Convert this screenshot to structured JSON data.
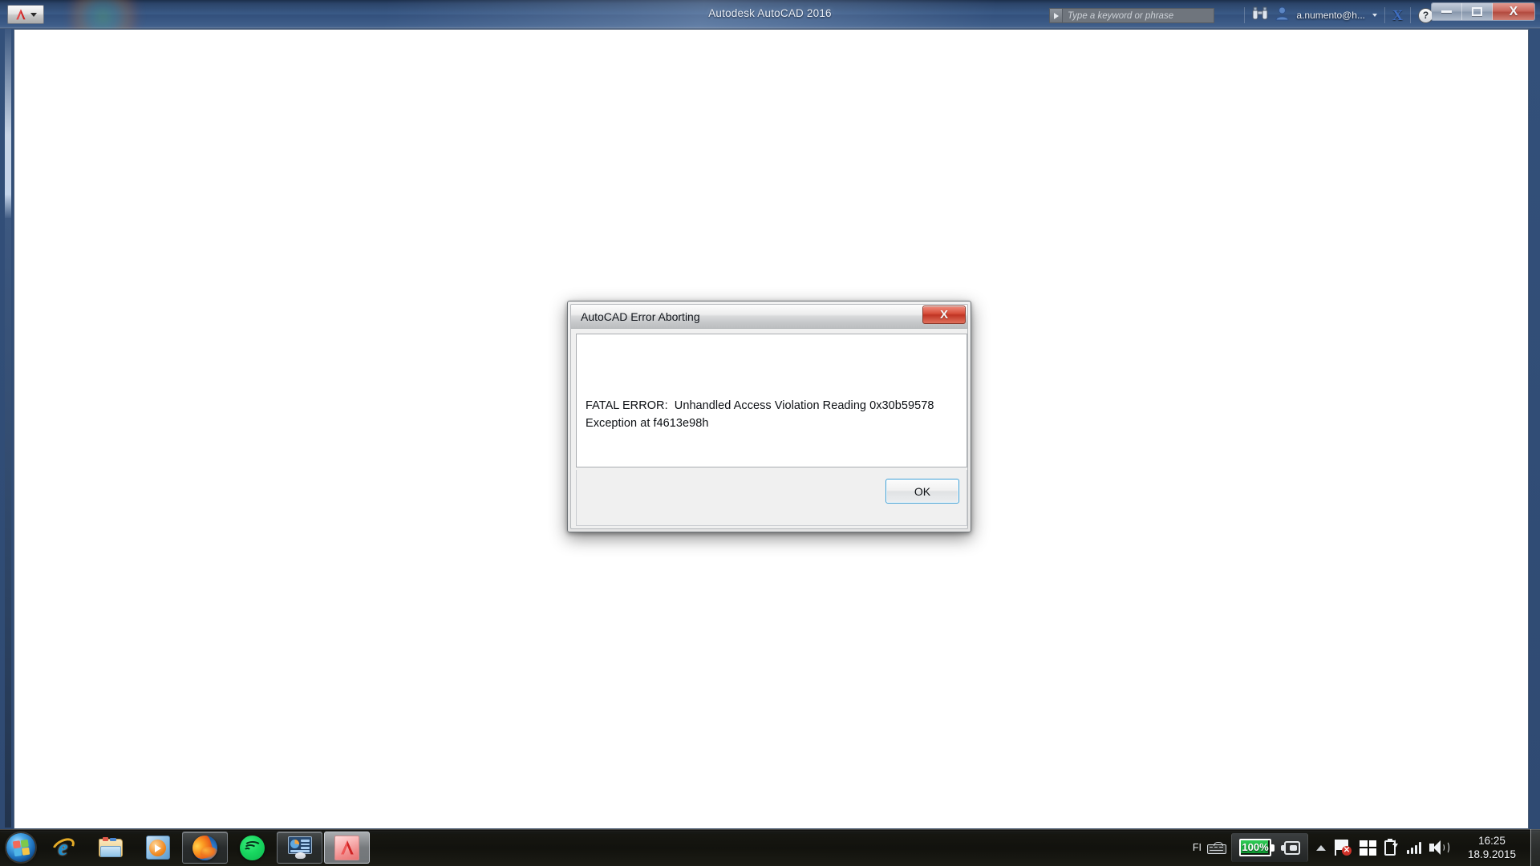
{
  "app": {
    "title": "Autodesk AutoCAD 2016",
    "app_menu_icon": "autocad-a-icon",
    "app_menu_caret": "chevron-down-icon"
  },
  "infocenter": {
    "search_placeholder": "Type a keyword or phrase",
    "search_value": "",
    "expand_icon": "play-arrow-icon",
    "binoculars_icon": "binoculars-icon",
    "user_icon": "user-icon",
    "user_label": "a.numento@h...",
    "user_caret": "chevron-down-icon",
    "exchange_label": "X",
    "help_label": "?",
    "help_caret": "chevron-down-icon"
  },
  "window_controls": {
    "minimize": "minimize-icon",
    "maximize": "restore-icon",
    "close": "X"
  },
  "dialog": {
    "title": "AutoCAD Error Aborting",
    "close_label": "X",
    "message_line1": "FATAL ERROR:  Unhandled Access Violation Reading 0x30b59578",
    "message_line2": "Exception at f4613e98h",
    "ok_label": "OK"
  },
  "taskbar": {
    "start_label": "Start",
    "buttons": [
      {
        "name": "internet-explorer",
        "state": "pinned"
      },
      {
        "name": "windows-explorer",
        "state": "pinned"
      },
      {
        "name": "windows-media-player",
        "state": "pinned"
      },
      {
        "name": "firefox",
        "state": "active"
      },
      {
        "name": "spotify",
        "state": "pinned"
      },
      {
        "name": "presentation-monitor",
        "state": "active"
      },
      {
        "name": "autocad",
        "state": "active-light"
      }
    ],
    "tray": {
      "language": "FI",
      "keyboard_icon": "keyboard-icon",
      "battery_percent": "100%",
      "power_plug_icon": "power-plug-icon",
      "show_hidden_icon": "chevron-up-icon",
      "action_center_icon": "flag-error-icon",
      "action_center_badge": "✕",
      "get_windows10_icon": "windows-logo-icon",
      "power_icon": "battery-charging-icon",
      "network_icon": "signal-bars-icon",
      "volume_icon": "speaker-icon",
      "time": "16:25",
      "date": "18.9.2015",
      "show_desktop": "show-desktop-button"
    }
  },
  "colors": {
    "titlebar_blue": "#3a5a87",
    "close_red": "#c03524",
    "focus_blue": "#3c9fd6",
    "battery_green": "#18d760",
    "accent_orange": "#ef6f1b"
  }
}
